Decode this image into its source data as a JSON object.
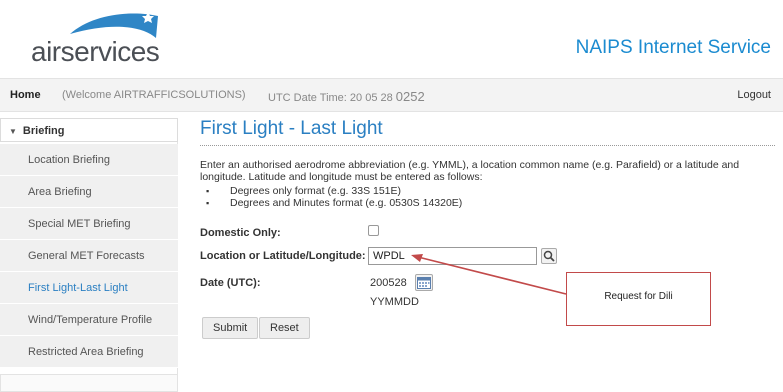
{
  "header": {
    "logo_text": "airservices",
    "service_title": "NAIPS Internet Service"
  },
  "navbar": {
    "home": "Home",
    "welcome": "(Welcome AIRTRAFFICSOLUTIONS)",
    "utc_label": "UTC Date Time: 20 05 28 ",
    "utc_time": "0252",
    "logout": "Logout"
  },
  "sidebar": {
    "section": "Briefing",
    "items": [
      {
        "label": "Location Briefing"
      },
      {
        "label": "Area Briefing"
      },
      {
        "label": "Special MET Briefing"
      },
      {
        "label": "General MET Forecasts"
      },
      {
        "label": "First Light-Last Light"
      },
      {
        "label": "Wind/Temperature Profile"
      },
      {
        "label": "Restricted Area Briefing"
      }
    ]
  },
  "main": {
    "title": "First Light - Last Light",
    "intro": "Enter an authorised aerodrome abbreviation (e.g. YMML), a location common name (e.g. Parafield) or a latitude and longitude. Latitude and longitude must be entered as follows:",
    "bullets": [
      "Degrees only format (e.g. 33S 151E)",
      "Degrees and Minutes format (e.g. 0530S 14320E)"
    ],
    "domestic_label": "Domestic Only:",
    "location_label": "Location or Latitude/Longitude: ",
    "required_mark": "*",
    "location_value": "WPDL",
    "date_label": "Date (UTC):",
    "date_value": "200528",
    "date_hint": "YYMMDD",
    "submit": "Submit",
    "reset": "Reset"
  },
  "annotation": {
    "text": "Request for Dili",
    "color": "#c24a4a"
  },
  "colors": {
    "accent": "#2a7fc2",
    "brand_blue": "#1b8bd0"
  }
}
